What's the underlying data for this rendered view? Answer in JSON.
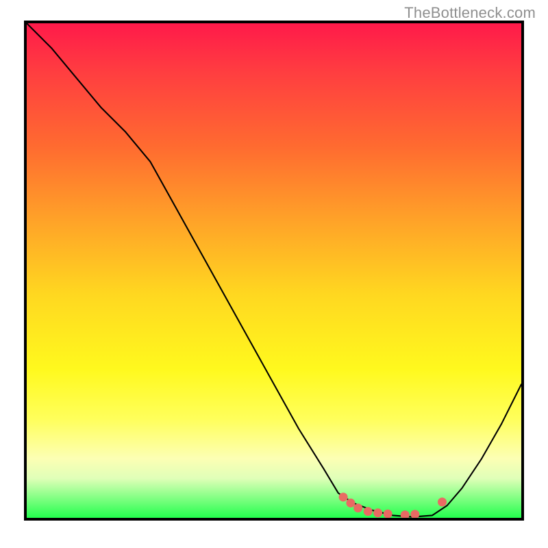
{
  "watermark": "TheBottleneck.com",
  "chart_data": {
    "type": "line",
    "title": "",
    "xlabel": "",
    "ylabel": "",
    "xlim": [
      0,
      100
    ],
    "ylim": [
      0,
      100
    ],
    "series": [
      {
        "name": "curve",
        "x": [
          0,
          5,
          10,
          15,
          20,
          25,
          30,
          35,
          40,
          45,
          50,
          55,
          60,
          63,
          66,
          70,
          74,
          78,
          82,
          85,
          88,
          92,
          96,
          100
        ],
        "y": [
          100,
          95,
          89,
          83,
          78,
          72,
          63,
          54,
          45,
          36,
          27,
          18,
          10,
          5,
          3,
          1.5,
          0.5,
          0.2,
          0.5,
          2.5,
          6,
          12,
          19,
          27
        ]
      },
      {
        "name": "markers",
        "points": [
          {
            "x": 64,
            "y": 4.2
          },
          {
            "x": 65.5,
            "y": 3.0
          },
          {
            "x": 67,
            "y": 2.0
          },
          {
            "x": 69,
            "y": 1.3
          },
          {
            "x": 71,
            "y": 1.0
          },
          {
            "x": 73,
            "y": 0.8
          },
          {
            "x": 76.5,
            "y": 0.6
          },
          {
            "x": 78.5,
            "y": 0.7
          },
          {
            "x": 84,
            "y": 3.2
          }
        ]
      }
    ],
    "gradient_stops": [
      {
        "offset": 0,
        "color": "#ff1a4a"
      },
      {
        "offset": 25,
        "color": "#ff6b30"
      },
      {
        "offset": 55,
        "color": "#ffd820"
      },
      {
        "offset": 80,
        "color": "#ffff5b"
      },
      {
        "offset": 100,
        "color": "#23ff4e"
      }
    ]
  }
}
